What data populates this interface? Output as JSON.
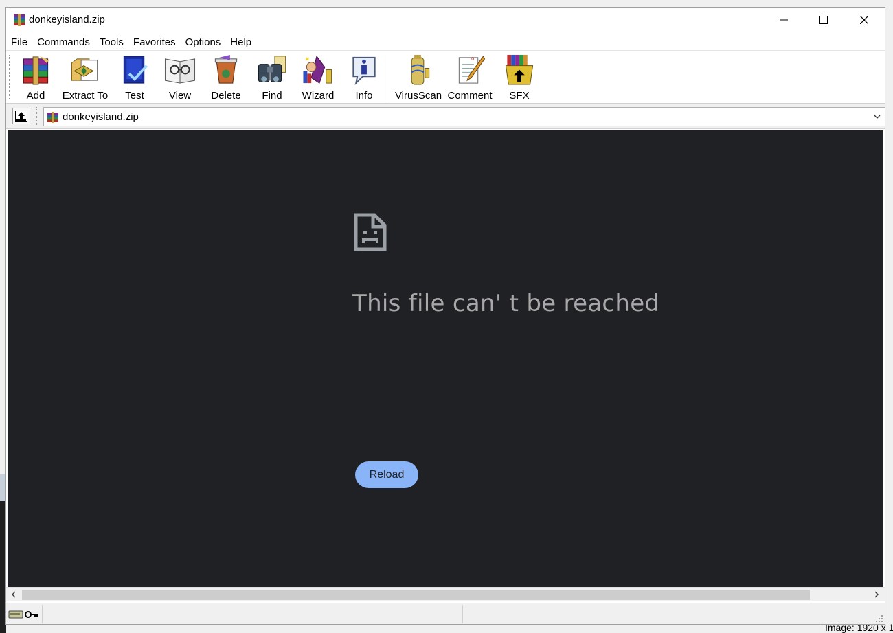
{
  "window": {
    "title": "donkeyisland.zip"
  },
  "menu": [
    "File",
    "Commands",
    "Tools",
    "Favorites",
    "Options",
    "Help"
  ],
  "toolbar": {
    "buttons": [
      {
        "label": "Add",
        "icon": "add-archive-icon"
      },
      {
        "label": "Extract To",
        "icon": "extract-icon"
      },
      {
        "label": "Test",
        "icon": "test-icon"
      },
      {
        "label": "View",
        "icon": "view-icon"
      },
      {
        "label": "Delete",
        "icon": "delete-icon"
      },
      {
        "label": "Find",
        "icon": "find-icon"
      },
      {
        "label": "Wizard",
        "icon": "wizard-icon"
      },
      {
        "label": "Info",
        "icon": "info-icon"
      },
      {
        "label": "VirusScan",
        "icon": "virusscan-icon"
      },
      {
        "label": "Comment",
        "icon": "comment-icon"
      },
      {
        "label": "SFX",
        "icon": "sfx-icon"
      }
    ]
  },
  "address": {
    "path": "donkeyisland.zip"
  },
  "error_page": {
    "title": "This file can' t be reached",
    "reload_label": "Reload",
    "icon": "broken-file-icon"
  },
  "background": {
    "image_info": "Image:  1920 x 1"
  },
  "colors": {
    "content_bg": "#202124",
    "button_bg": "#8ab4f8",
    "error_text": "#a8a8a8"
  }
}
